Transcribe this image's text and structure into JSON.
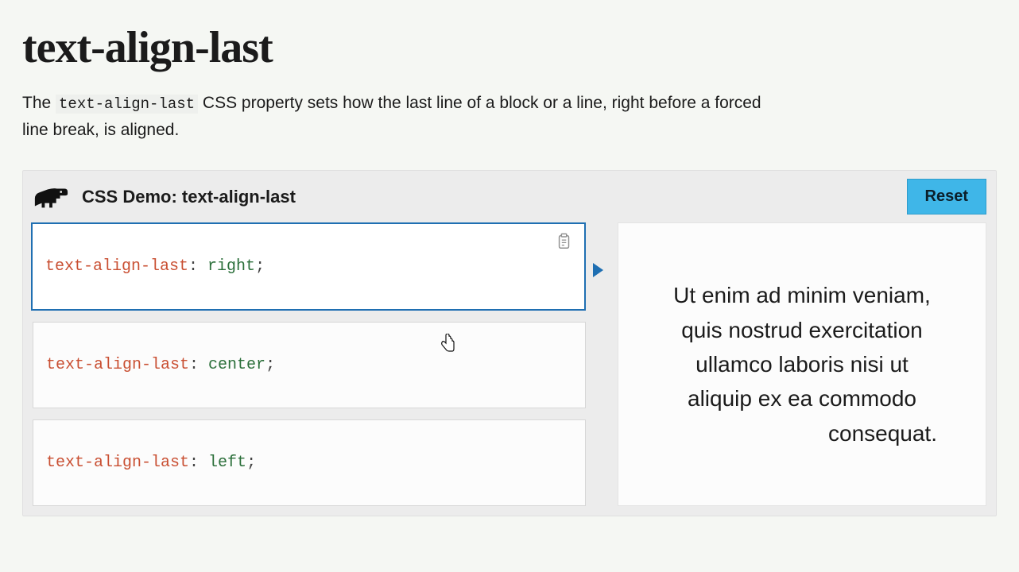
{
  "page": {
    "title": "text-align-last",
    "description_before": "The ",
    "description_code": "text-align-last",
    "description_after": " CSS property sets how the last line of a block or a line, right before a forced line break, is aligned."
  },
  "demo": {
    "title": "CSS Demo: text-align-last",
    "reset_label": "Reset",
    "options": [
      {
        "property": "text-align-last",
        "value": "right",
        "selected": true
      },
      {
        "property": "text-align-last",
        "value": "center",
        "selected": false
      },
      {
        "property": "text-align-last",
        "value": "left",
        "selected": false
      }
    ],
    "preview_text": "Ut enim ad minim veniam, quis nostrud exercitation ullamco laboris nisi ut aliquip ex ea commodo consequat."
  },
  "icons": {
    "clipboard": "clipboard-icon",
    "arrow": "play-arrow-icon",
    "logo": "dino-logo"
  }
}
